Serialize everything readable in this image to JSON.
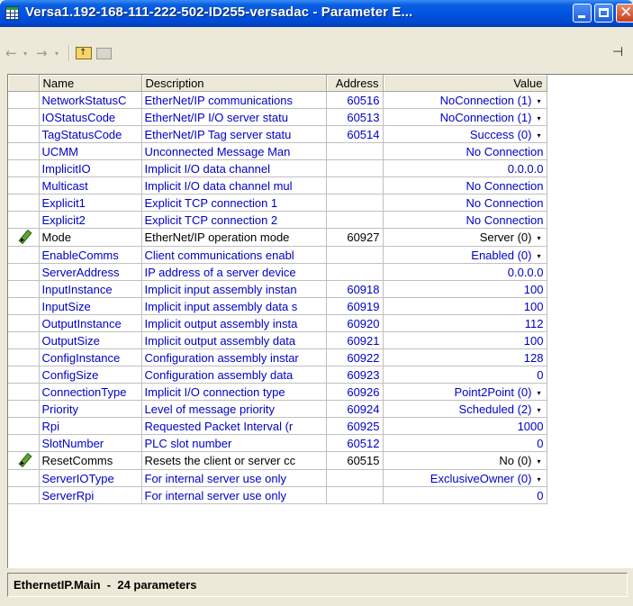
{
  "window": {
    "title": "Versa1.192-168-111-222-502-ID255-versadac - Parameter E...",
    "icon": "table-icon"
  },
  "toolbar": {
    "back_icon": "back-arrow-icon",
    "forward_icon": "forward-arrow-icon",
    "up_icon": "folder-up-icon",
    "folder_icon": "folder-icon",
    "pin_icon": "pin-icon",
    "back_glyph": "←",
    "dd_glyph": "▾",
    "forward_glyph": "→",
    "up_glyph": "↑",
    "pin_glyph": "⊣"
  },
  "table": {
    "columns": [
      "Name",
      "Description",
      "Address",
      "Value"
    ],
    "rows": [
      {
        "name": "NetworkStatusC",
        "description": "EtherNet/IP communications",
        "address": "60516",
        "value": "NoConnection (1)",
        "dropdown": true,
        "editable": false,
        "pencil": false
      },
      {
        "name": "IOStatusCode",
        "description": "EtherNet/IP I/O server statu",
        "address": "60513",
        "value": "NoConnection (1)",
        "dropdown": true,
        "editable": false,
        "pencil": false
      },
      {
        "name": "TagStatusCode",
        "description": "EtherNet/IP Tag server statu",
        "address": "60514",
        "value": "Success (0)",
        "dropdown": true,
        "editable": false,
        "pencil": false
      },
      {
        "name": "UCMM",
        "description": "Unconnected Message Man",
        "address": "",
        "value": "No Connection",
        "dropdown": false,
        "editable": false,
        "pencil": false
      },
      {
        "name": "ImplicitIO",
        "description": "Implicit I/O data channel",
        "address": "",
        "value": "0.0.0.0",
        "dropdown": false,
        "editable": false,
        "pencil": false
      },
      {
        "name": "Multicast",
        "description": "Implicit I/O data channel mul",
        "address": "",
        "value": "No Connection",
        "dropdown": false,
        "editable": false,
        "pencil": false
      },
      {
        "name": "Explicit1",
        "description": "Explicit TCP connection 1",
        "address": "",
        "value": "No Connection",
        "dropdown": false,
        "editable": false,
        "pencil": false
      },
      {
        "name": "Explicit2",
        "description": "Explicit TCP connection 2",
        "address": "",
        "value": "No Connection",
        "dropdown": false,
        "editable": false,
        "pencil": false
      },
      {
        "name": "Mode",
        "description": "EtherNet/IP operation mode",
        "address": "60927",
        "value": "Server (0)",
        "dropdown": true,
        "editable": true,
        "pencil": true
      },
      {
        "name": "EnableComms",
        "description": "Client communications enabl",
        "address": "",
        "value": "Enabled (0)",
        "dropdown": true,
        "editable": false,
        "pencil": false
      },
      {
        "name": "ServerAddress",
        "description": "IP address of a server device",
        "address": "",
        "value": "0.0.0.0",
        "dropdown": false,
        "editable": false,
        "pencil": false
      },
      {
        "name": "InputInstance",
        "description": "Implicit input assembly instan",
        "address": "60918",
        "value": "100",
        "dropdown": false,
        "editable": false,
        "pencil": false
      },
      {
        "name": "InputSize",
        "description": "Implicit input assembly data s",
        "address": "60919",
        "value": "100",
        "dropdown": false,
        "editable": false,
        "pencil": false
      },
      {
        "name": "OutputInstance",
        "description": "Implicit output assembly insta",
        "address": "60920",
        "value": "112",
        "dropdown": false,
        "editable": false,
        "pencil": false
      },
      {
        "name": "OutputSize",
        "description": "Implicit output assembly data",
        "address": "60921",
        "value": "100",
        "dropdown": false,
        "editable": false,
        "pencil": false
      },
      {
        "name": "ConfigInstance",
        "description": "Configuration assembly instar",
        "address": "60922",
        "value": "128",
        "dropdown": false,
        "editable": false,
        "pencil": false
      },
      {
        "name": "ConfigSize",
        "description": "Configuration assembly data",
        "address": "60923",
        "value": "0",
        "dropdown": false,
        "editable": false,
        "pencil": false
      },
      {
        "name": "ConnectionType",
        "description": "Implicit I/O connection type",
        "address": "60926",
        "value": "Point2Point (0)",
        "dropdown": true,
        "editable": false,
        "pencil": false
      },
      {
        "name": "Priority",
        "description": "Level of message priority",
        "address": "60924",
        "value": "Scheduled (2)",
        "dropdown": true,
        "editable": false,
        "pencil": false
      },
      {
        "name": "Rpi",
        "description": "Requested Packet Interval (r",
        "address": "60925",
        "value": "1000",
        "dropdown": false,
        "editable": false,
        "pencil": false
      },
      {
        "name": "SlotNumber",
        "description": "PLC slot number",
        "address": "60512",
        "value": "0",
        "dropdown": false,
        "editable": false,
        "pencil": false
      },
      {
        "name": "ResetComms",
        "description": "Resets the client or server cc",
        "address": "60515",
        "value": "No (0)",
        "dropdown": true,
        "editable": true,
        "pencil": true
      },
      {
        "name": "ServerIOType",
        "description": "For internal server use only",
        "address": "",
        "value": "ExclusiveOwner (0)",
        "dropdown": true,
        "editable": false,
        "pencil": false
      },
      {
        "name": "ServerRpi",
        "description": "For internal server use only",
        "address": "",
        "value": "0",
        "dropdown": false,
        "editable": false,
        "pencil": false
      }
    ]
  },
  "status": {
    "text": "EthernetIP.Main  -  24 parameters"
  }
}
